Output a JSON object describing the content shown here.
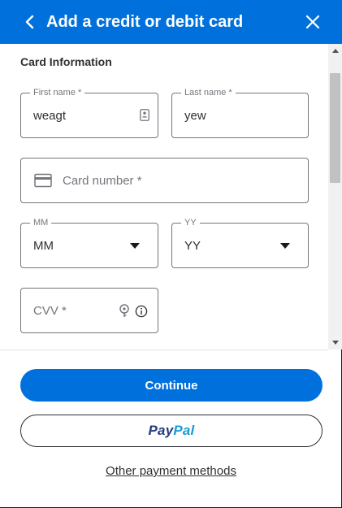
{
  "header": {
    "title": "Add a credit or debit card",
    "background": "#0071dc"
  },
  "section": {
    "title": "Card Information"
  },
  "fields": {
    "first_name": {
      "label": "First name *",
      "value": "weagt"
    },
    "last_name": {
      "label": "Last name *",
      "value": "yew"
    },
    "card_number": {
      "placeholder": "Card number *"
    },
    "month": {
      "label": "MM",
      "value": "MM"
    },
    "year": {
      "label": "YY",
      "value": "YY"
    },
    "cvv": {
      "placeholder": "CVV *"
    }
  },
  "actions": {
    "continue_label": "Continue",
    "paypal_pay": "Pay",
    "paypal_pal": "Pal",
    "other_methods_label": "Other payment methods"
  },
  "colors": {
    "primary": "#0071dc",
    "paypal_dark": "#253b80",
    "paypal_light": "#179bd7"
  }
}
